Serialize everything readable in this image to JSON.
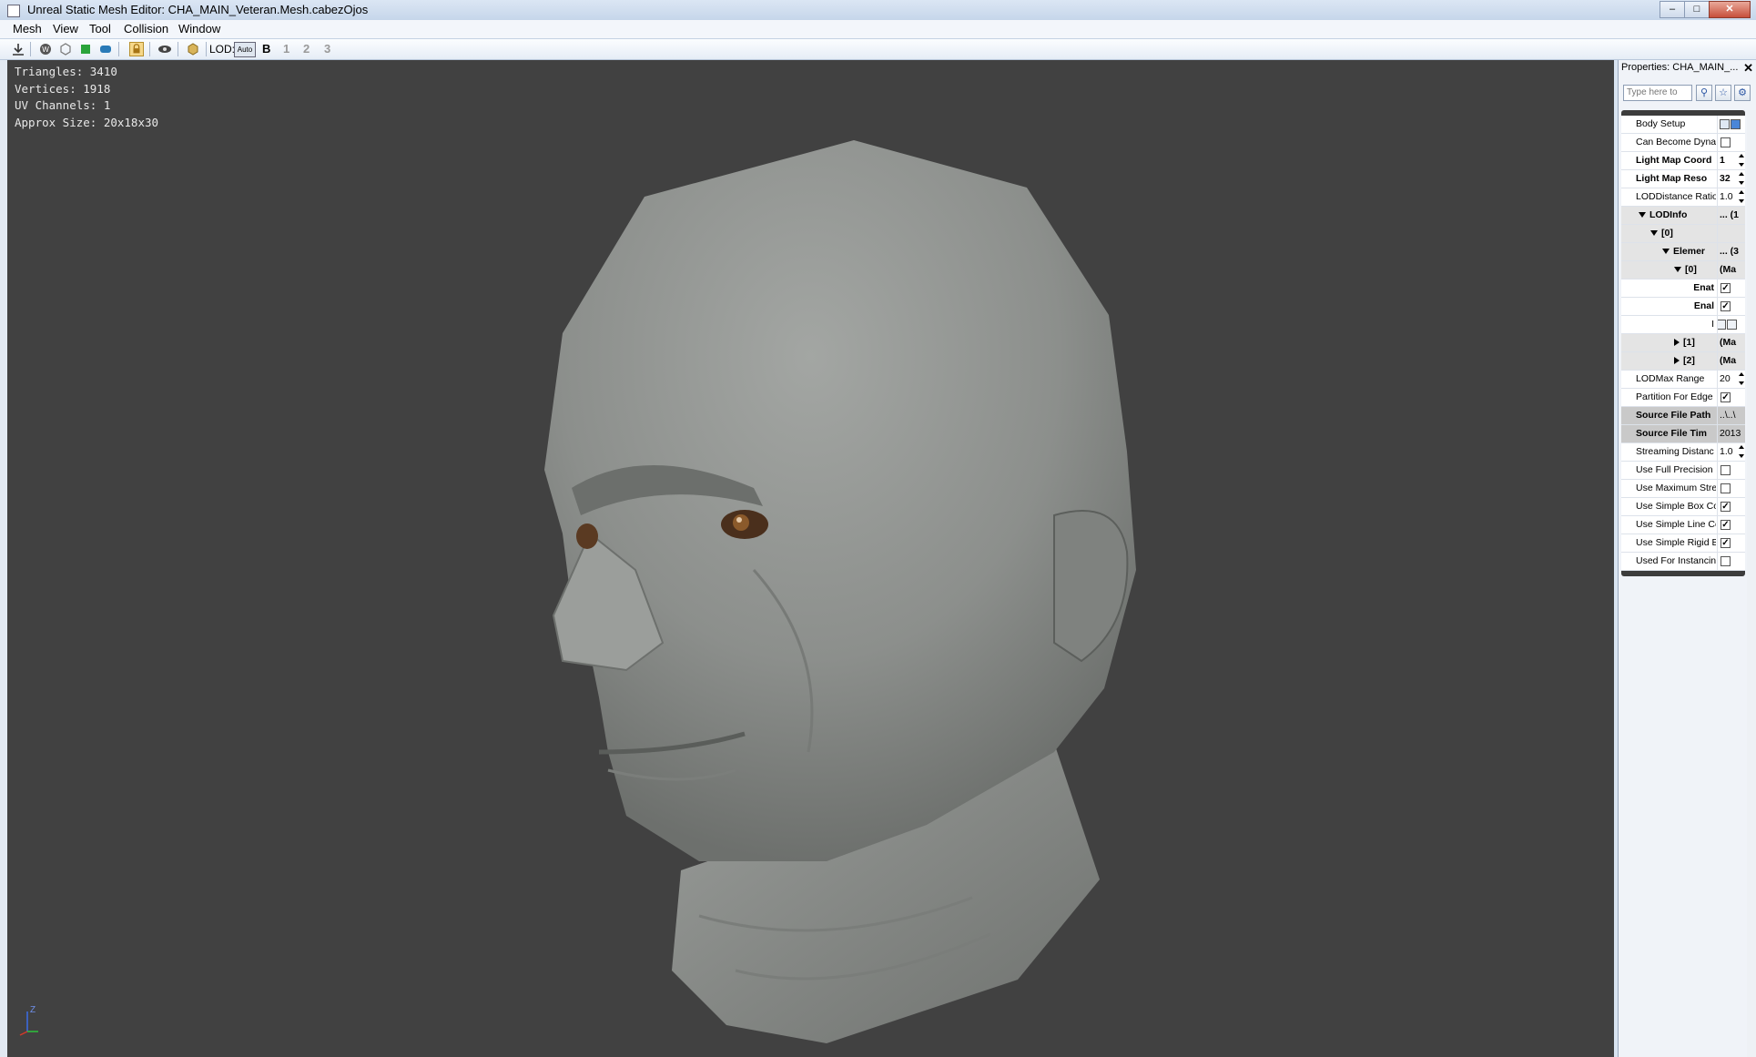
{
  "window": {
    "title": "Unreal Static Mesh Editor: CHA_MAIN_Veteran.Mesh.cabezOjos",
    "controls": [
      "minimize-icon",
      "maximize-icon",
      "close-icon"
    ]
  },
  "menu": [
    "Mesh",
    "View",
    "Tool",
    "Collision",
    "Window"
  ],
  "toolbar": {
    "lod_label": "LOD:",
    "lod_auto": "Auto",
    "lod_base": "B",
    "lod_levels": [
      "1",
      "2",
      "3"
    ]
  },
  "stats": {
    "triangles": "Triangles:  3410",
    "vertices": "Vertices:  1918",
    "uv_channels": "UV Channels:  1",
    "approx_size": "Approx Size: 20x18x30"
  },
  "axis": {
    "z_label": "Z"
  },
  "properties": {
    "title": "Properties: CHA_MAIN_...",
    "search_placeholder": "Type here to",
    "rows": [
      {
        "label": "Body Setup",
        "value": "",
        "type": "buttons"
      },
      {
        "label": "Can Become Dyna",
        "value": "",
        "type": "check",
        "checked": false
      },
      {
        "label": "Light Map Coord",
        "value": "1",
        "type": "spin",
        "bold": true
      },
      {
        "label": "Light Map Reso",
        "value": "32",
        "type": "spin",
        "bold": true
      },
      {
        "label": "LODDistance Ratio",
        "value": "1.0",
        "type": "spin"
      },
      {
        "label": "LODInfo",
        "value": "... (1",
        "type": "group",
        "bold": true,
        "indent": 1
      },
      {
        "label": "[0]",
        "value": "",
        "type": "group",
        "bold": true,
        "indent": 2
      },
      {
        "label": "Elemer",
        "value": "... (3",
        "type": "group",
        "bold": true,
        "indent": 3
      },
      {
        "label": "[0]",
        "value": "(Ma",
        "type": "group",
        "bold": true,
        "indent": 4
      },
      {
        "label": "Enat",
        "value": "",
        "type": "check",
        "checked": true,
        "bold": true,
        "align": "right"
      },
      {
        "label": "Enal",
        "value": "",
        "type": "check",
        "checked": true,
        "bold": true,
        "align": "right"
      },
      {
        "label": "I",
        "value": "",
        "type": "icons",
        "align": "right"
      },
      {
        "label": "[1]",
        "value": "(Ma",
        "type": "collapsed",
        "bold": true,
        "indent": 4
      },
      {
        "label": "[2]",
        "value": "(Ma",
        "type": "collapsed",
        "bold": true,
        "indent": 4
      },
      {
        "label": "LODMax Range",
        "value": "20",
        "type": "spin"
      },
      {
        "label": "Partition For Edge",
        "value": "",
        "type": "check",
        "checked": true
      },
      {
        "label": "Source File Path",
        "value": "..\\..\\",
        "type": "text",
        "grey": true
      },
      {
        "label": "Source File Tim",
        "value": "2013",
        "type": "text",
        "grey": true
      },
      {
        "label": "Streaming Distanc",
        "value": "1.0",
        "type": "spin"
      },
      {
        "label": "Use Full Precision",
        "value": "",
        "type": "check",
        "checked": false
      },
      {
        "label": "Use Maximum Stre",
        "value": "",
        "type": "check",
        "checked": false
      },
      {
        "label": "Use Simple Box Co",
        "value": "",
        "type": "check",
        "checked": true
      },
      {
        "label": "Use Simple Line Co",
        "value": "",
        "type": "check",
        "checked": true
      },
      {
        "label": "Use Simple Rigid B",
        "value": "",
        "type": "check",
        "checked": true
      },
      {
        "label": "Used For Instancin",
        "value": "",
        "type": "check",
        "checked": false
      }
    ]
  },
  "colors": {
    "viewport_bg": "#414141",
    "mesh_gray": "#8c8f8c",
    "titlebar": "#c6d6ea",
    "group_row": "#c9c9c9"
  }
}
